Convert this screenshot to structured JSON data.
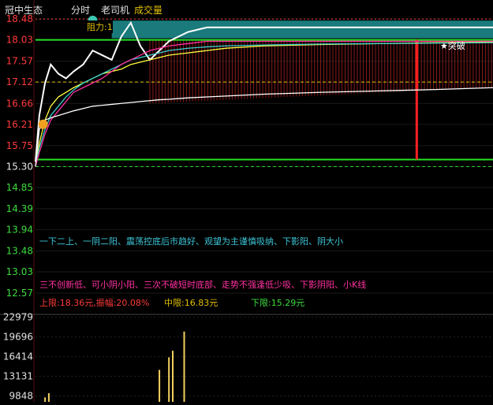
{
  "header": {
    "stock_name": "冠中生态",
    "mode": "分时",
    "indicator": "老司机",
    "volume_label": "成交量",
    "colors": {
      "text": "#d0d0d0",
      "volume_label": "#e0c000"
    }
  },
  "chart_data": [
    {
      "type": "line",
      "title": "",
      "y_axis_ticks": [
        "18.48",
        "18.03",
        "17.57",
        "17.12",
        "16.66",
        "16.21",
        "15.75",
        "15.30",
        "14.85",
        "14.39",
        "13.94",
        "13.48",
        "13.03",
        "12.57"
      ],
      "tick_colors": {
        "up": "#ff3b3b",
        "base": "#e8e8e8",
        "down": "#3ddc3d"
      },
      "ylim": [
        12.35,
        18.55
      ],
      "prev_close": 15.3,
      "x": [
        0,
        2,
        5,
        8,
        12,
        16,
        20,
        25,
        30,
        35,
        40,
        45,
        50,
        55,
        60,
        65,
        70,
        80,
        90,
        100,
        120,
        150,
        180,
        210,
        240
      ],
      "series": [
        {
          "name": "",
          "color": "#ffffff",
          "values": [
            15.4,
            16.4,
            17.1,
            17.5,
            17.3,
            17.2,
            17.35,
            17.5,
            17.8,
            17.7,
            17.6,
            18.1,
            18.4,
            17.9,
            17.6,
            17.8,
            18.0,
            18.2,
            18.3,
            18.3,
            18.3,
            18.3,
            18.3,
            18.3,
            18.3
          ]
        },
        {
          "name": "",
          "color": "#ffff40",
          "values": [
            15.3,
            15.8,
            16.3,
            16.6,
            16.8,
            16.9,
            17.0,
            17.1,
            17.2,
            17.3,
            17.35,
            17.4,
            17.5,
            17.55,
            17.6,
            17.65,
            17.7,
            17.75,
            17.8,
            17.85,
            17.9,
            17.93,
            17.95,
            17.97,
            17.98
          ]
        },
        {
          "name": "",
          "color": "#3cd0d0",
          "values": [
            15.3,
            15.7,
            16.1,
            16.4,
            16.6,
            16.8,
            16.95,
            17.1,
            17.2,
            17.3,
            17.4,
            17.5,
            17.6,
            17.65,
            17.7,
            17.75,
            17.8,
            17.85,
            17.88,
            17.9,
            17.92,
            17.94,
            17.95,
            17.96,
            17.97
          ]
        },
        {
          "name": "",
          "color": "#ff30a0",
          "values": [
            15.3,
            15.6,
            16.0,
            16.3,
            16.5,
            16.7,
            16.9,
            17.0,
            17.1,
            17.2,
            17.35,
            17.5,
            17.6,
            17.7,
            17.8,
            17.85,
            17.9,
            17.95,
            18.0,
            18.0,
            18.0,
            18.0,
            18.0,
            18.0,
            18.0
          ]
        },
        {
          "name": "",
          "color": "#ffffff",
          "values": [
            15.3,
            16.1,
            16.3,
            16.35,
            16.4,
            16.45,
            16.5,
            16.55,
            16.6,
            16.62,
            16.64,
            16.66,
            16.68,
            16.7,
            16.72,
            16.74,
            16.75,
            16.78,
            16.8,
            16.82,
            16.86,
            16.9,
            16.93,
            16.96,
            17.0
          ]
        }
      ],
      "hlines": [
        {
          "value": 18.03,
          "color": "#27e027"
        },
        {
          "value": 15.45,
          "color": "#27e027"
        },
        {
          "value": 17.12,
          "color": "#e0c000",
          "style": "dashed"
        },
        {
          "value": 15.3,
          "color": "#27e027",
          "style": "dashed"
        },
        {
          "value": 18.48,
          "color": "#ff3b3b",
          "style": "dotted"
        }
      ],
      "signal_line": {
        "x": 200,
        "from": 15.45,
        "to": 18.03,
        "color": "#ff2020"
      },
      "band": {
        "x_start": 60,
        "x_end": 240,
        "top": 18.03,
        "color": "#8b1a1a"
      },
      "annotations": {
        "resistance": "阻力:1",
        "breakout": "突破",
        "pattern_up": "一下二上、一阴二阳、震荡控底后市趋好、观望为主谨慎吸纳、下影阳、阴大小",
        "pattern_down": "三不创新低、可小阴小阳、三次不破短时底部、走势不强逢低少吸、下影阴阳、小K线",
        "upper_limit": "上限:18.36元,振幅:20.08%",
        "mid_limit": "中限:16.83元",
        "lower_limit": "下限:15.29元"
      }
    },
    {
      "type": "bar",
      "title": "成交量",
      "y_axis_ticks": [
        "22979",
        "19696",
        "16414",
        "13131",
        "9848"
      ],
      "ylim": [
        8200,
        23600
      ],
      "color": "#f2d060",
      "x": [
        5,
        7,
        65,
        70,
        72,
        78
      ],
      "values": [
        9600,
        10300,
        14200,
        16300,
        17400,
        20600
      ]
    }
  ]
}
